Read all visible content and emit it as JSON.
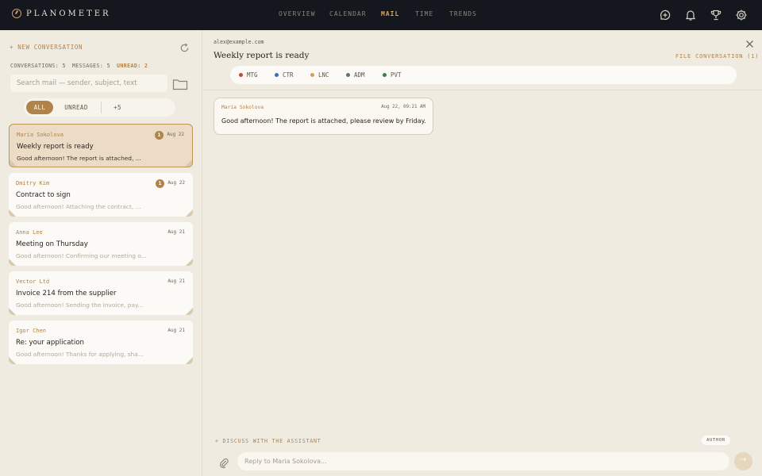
{
  "app": {
    "name": "PLANOMETER"
  },
  "nav": [
    {
      "label": "OVERVIEW",
      "active": false
    },
    {
      "label": "CALENDAR",
      "active": false
    },
    {
      "label": "MAIL",
      "active": true
    },
    {
      "label": "TIME",
      "active": false
    },
    {
      "label": "TRENDS",
      "active": false
    }
  ],
  "top_icons": [
    "compose-icon",
    "bell-icon",
    "trophy-icon",
    "gear-icon"
  ],
  "sidebar": {
    "new_conversation": "+ NEW CONVERSATION",
    "stats": {
      "conversations": "CONVERSATIONS: 5",
      "messages": "MESSAGES: 5",
      "unread": "UNREAD: 2"
    },
    "search_placeholder": "Search mail — sender, subject, text",
    "filters": [
      {
        "label": "ALL",
        "active": true
      },
      {
        "label": "UNREAD",
        "active": false
      },
      {
        "label": "+5",
        "active": false
      }
    ],
    "conversations": [
      {
        "sender": "Maria Sokolova",
        "badge": "1",
        "date": "Aug 22",
        "subject": "Weekly report is ready",
        "preview": "Good afternoon! The report is attached, ...",
        "selected": true
      },
      {
        "sender": "Dmitry Kim",
        "badge": "1",
        "date": "Aug 22",
        "subject": "Contract to sign",
        "preview": "Good afternoon! Attaching the contract, ...",
        "selected": false
      },
      {
        "sender": "Anna Lee",
        "badge": "",
        "date": "Aug 21",
        "subject": "Meeting on Thursday",
        "preview": "Good afternoon! Confirming our meeting o...",
        "selected": false
      },
      {
        "sender": "Vector Ltd",
        "badge": "",
        "date": "Aug 21",
        "subject": "Invoice 214 from the supplier",
        "preview": "Good afternoon! Sending the invoice, pay...",
        "selected": false
      },
      {
        "sender": "Igor Chen",
        "badge": "",
        "date": "Aug 21",
        "subject": "Re: your application",
        "preview": "Good afternoon! Thanks for applying, sha...",
        "selected": false
      }
    ]
  },
  "thread": {
    "email": "alex@example.com",
    "subject": "Weekly report is ready",
    "file_conversation": "FILE CONVERSATION (1)",
    "tags": [
      {
        "label": "MTG",
        "color": "#c0473b"
      },
      {
        "label": "CTR",
        "color": "#3d6fb0"
      },
      {
        "label": "LNC",
        "color": "#d0a15e"
      },
      {
        "label": "ADM",
        "color": "#6b6f78"
      },
      {
        "label": "PVT",
        "color": "#3f7d4e"
      }
    ],
    "messages": [
      {
        "sender": "Maria Sokolova",
        "date": "Aug 22, 09:21 AM",
        "body": "Good afternoon! The report is attached, please review by Friday."
      }
    ],
    "assistant_label": "+ DISCUSS WITH THE ASSISTANT",
    "author_label": "AUTHOR",
    "reply_placeholder": "Reply to Maria Sokolova..."
  }
}
